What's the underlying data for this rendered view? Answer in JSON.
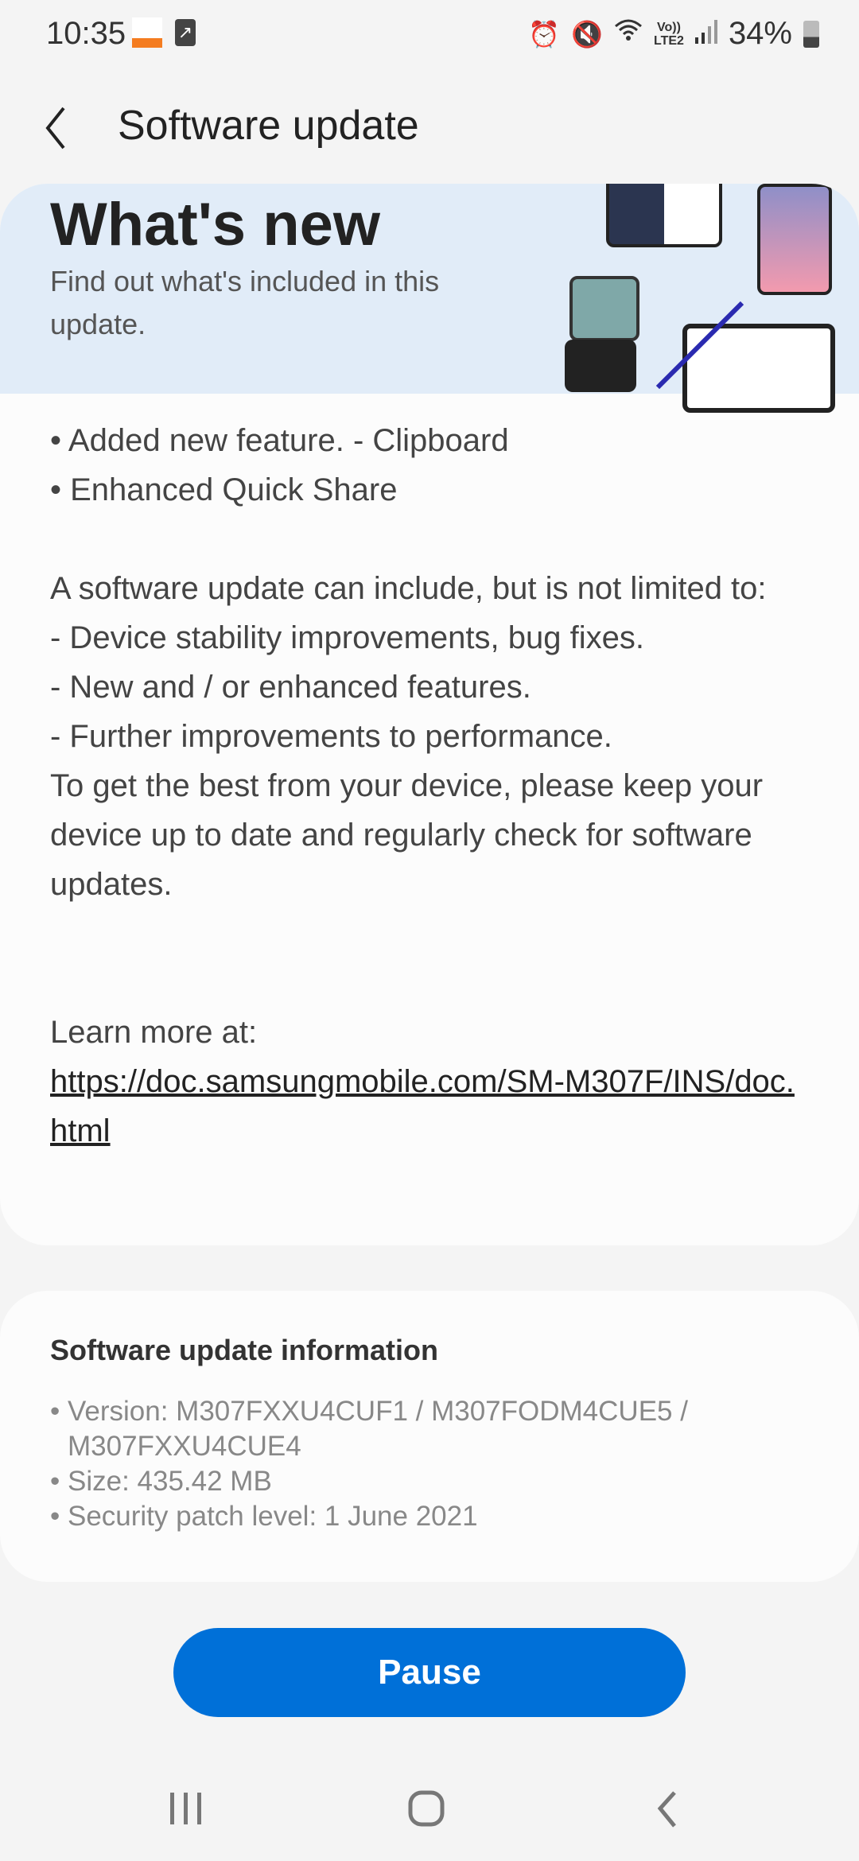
{
  "status_bar": {
    "time": "10:35",
    "notification_icons": [
      "buddy-app-icon",
      "screen-share-icon"
    ],
    "icons": [
      "alarm-icon",
      "mute-icon",
      "wifi-icon",
      "volte-lte2-icon",
      "signal-icon"
    ],
    "volte": "Vo))",
    "lte": "LTE2",
    "battery": "34%",
    "battery_level": 34
  },
  "header": {
    "title": "Software update"
  },
  "whats_new": {
    "title": "What's new",
    "subtitle": "Find out what's included in this update.",
    "features": [
      "• Added new feature. - Clipboard",
      "• Enhanced Quick Share"
    ],
    "description": [
      "A software update can include, but is not limited to:",
      " - Device stability improvements, bug fixes.",
      " - New and / or enhanced features.",
      " - Further improvements to performance.",
      "To get the best from your device, please keep your device up to date and regularly check for software updates."
    ],
    "learn_more": "Learn more at:",
    "link": "https://doc.samsungmobile.com/SM-M307F/INS/doc.html"
  },
  "info": {
    "title": "Software update information",
    "items": [
      "• Version: M307FXXU4CUF1 / M307FODM4CUE5 / M307FXXU4CUE4",
      "• Size: 435.42 MB",
      "• Security patch level: 1 June 2021"
    ]
  },
  "actions": {
    "pause": "Pause"
  },
  "colors": {
    "accent": "#0070d8",
    "banner": "#e1ecf8",
    "background": "#f4f4f4"
  }
}
